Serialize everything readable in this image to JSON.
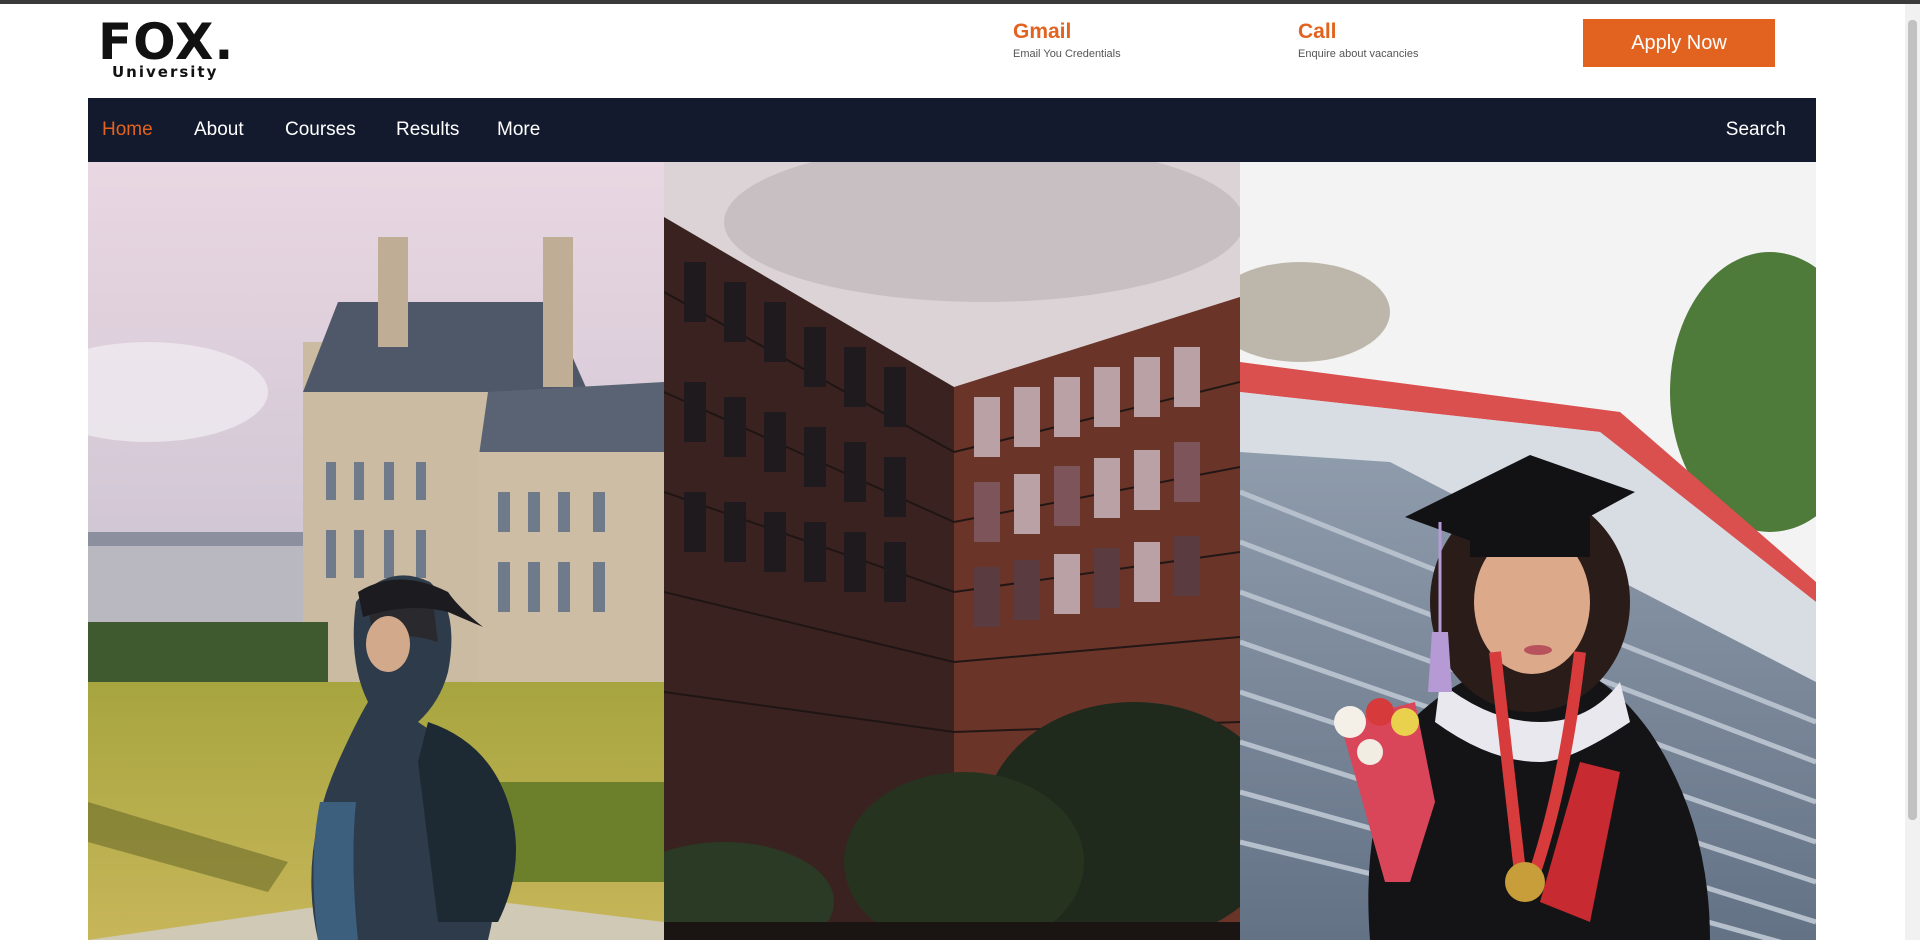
{
  "logo": {
    "main": "FOX.",
    "sub": "University"
  },
  "contacts": [
    {
      "title": "Gmail",
      "subtitle": "Email You Credentials"
    },
    {
      "title": "Call",
      "subtitle": "Enquire about vacancies"
    }
  ],
  "apply_button": "Apply Now",
  "nav": {
    "items": [
      "Home",
      "About",
      "Courses",
      "Results",
      "More"
    ],
    "active": "Home",
    "search_label": "Search"
  },
  "colors": {
    "accent": "#e2631f",
    "nav_bg": "#131a2d",
    "text_dark": "#111111"
  },
  "hero_images": [
    {
      "description_icon": "campus-photo"
    },
    {
      "description_icon": "building-photo"
    },
    {
      "description_icon": "graduate-photo"
    }
  ]
}
